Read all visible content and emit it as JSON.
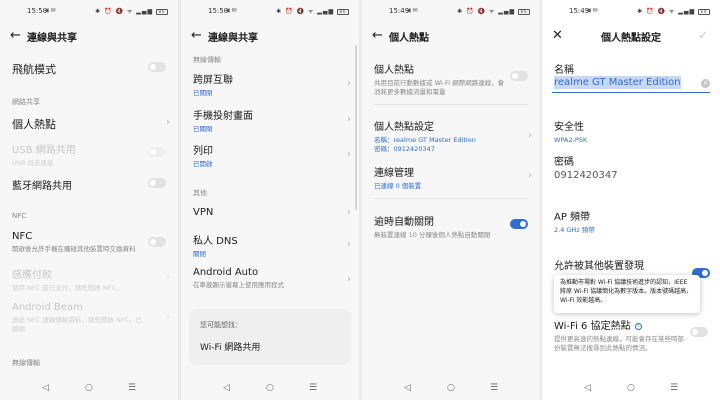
{
  "screens": [
    {
      "status": {
        "time": "15:50",
        "extra": "◀ ✉",
        "right": "✱ ⏰ 🔇 ᯤ ▂▄▆",
        "battery": "86"
      },
      "title": "連線與共享",
      "rows": [
        {
          "label": "飛航模式"
        },
        {
          "section": "網路共享"
        },
        {
          "label": "個人熱點"
        },
        {
          "label": "USB 網路共用",
          "desc": "USB 尚未連接"
        },
        {
          "label": "藍牙網路共用"
        },
        {
          "section": "NFC"
        },
        {
          "label": "NFC",
          "desc": "開啟後允許手機在觸碰其他裝置時交換資料"
        },
        {
          "label": "感應付款",
          "desc": "使用 NFC 進行支付，請先開啟 NFC。"
        },
        {
          "label": "Android Beam",
          "desc": "透過 NFC 連線傳輸資料，請先開啟 NFC。已關閉"
        },
        {
          "section": "無線傳輸"
        }
      ]
    },
    {
      "status": {
        "time": "15:50",
        "extra": "◀ ✉",
        "right": "✱ ⏰ 🔇 ᯤ ▂▄▆",
        "battery": "86"
      },
      "title": "連線與共享",
      "rows": [
        {
          "section": "無線傳輸"
        },
        {
          "label": "跨屏互聯",
          "desc": "已關閉"
        },
        {
          "label": "手機投射畫面",
          "desc": "已關閉"
        },
        {
          "label": "列印",
          "desc": "已開啟"
        },
        {
          "section": "其他"
        },
        {
          "label": "VPN"
        },
        {
          "label": "私人 DNS",
          "desc": "關閉"
        },
        {
          "label": "Android Auto",
          "desc": "在車載顯示螢幕上使用應用程式"
        }
      ],
      "suggest": {
        "caption": "您可能想找：",
        "link": "Wi-Fi 網路共用"
      }
    },
    {
      "status": {
        "time": "15:49",
        "extra": "◀ ✉",
        "right": "✱ ⏰ 🔇 ᯤ ▂▄▆",
        "battery": "86"
      },
      "title": "個人熱點",
      "rows": [
        {
          "label": "個人熱點",
          "desc": "共用目前行動數據或 Wi-Fi 網際網路連線，會消耗更多數據流量和電量"
        },
        {
          "label": "個人熱點設定",
          "desc1": "名稱：realme GT Master Edition",
          "desc2": "密碼：0912420347"
        },
        {
          "label": "連線管理",
          "desc": "已連線 0 個裝置"
        },
        {
          "label": "逾時自動關閉",
          "desc": "無裝置連線 10 分鐘後個人熱點自動關閉"
        }
      ]
    },
    {
      "status": {
        "time": "15:49",
        "extra": "◀ ✉",
        "right": "✱ ⏰ 🔇 ᯤ ▂▄▆",
        "battery": "86"
      },
      "title": "個人熱點設定",
      "name_label": "名稱",
      "name_value": "realme GT Master Edition",
      "security_label": "安全性",
      "security_value": "WPA2-PSK",
      "password_label": "密碼",
      "password_value": "0912420347",
      "band_label": "AP 頻帶",
      "band_value": "2.4 GHz 頻帶",
      "allow_label": "允許被其他裝置發現",
      "tooltip": "為推動市場對 Wi-Fi 協議技術進步的認知，IEEE 將原 Wi-Fi 協議簡化為數字版本。版本號碼越高，Wi-Fi 效能越高。",
      "wifi6_label": "Wi-Fi 6 協定熱點",
      "wifi6_desc": "提供更高速的熱點連線，可能會存在某些時部份裝置無法搜尋到此熱點的情況。"
    }
  ],
  "nav": {
    "back": "◁",
    "home": "○",
    "recents": "☰"
  },
  "colors": {
    "accent": "#2f6ecf"
  }
}
